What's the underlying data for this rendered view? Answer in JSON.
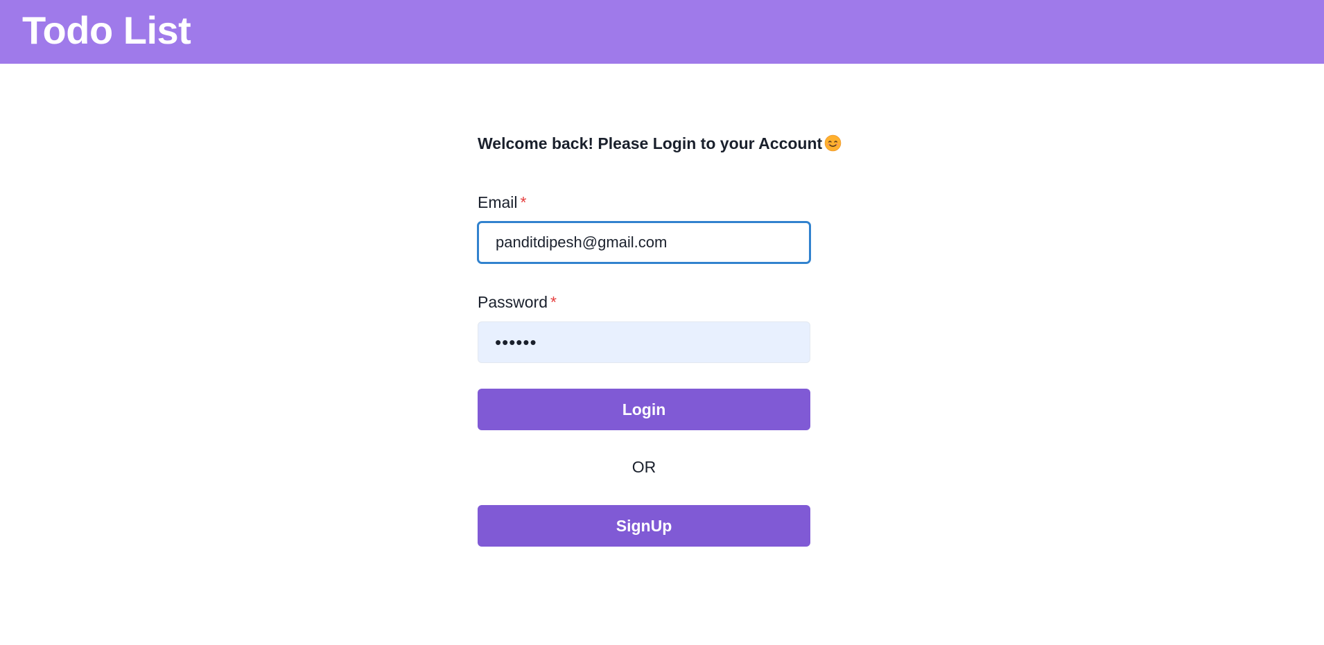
{
  "header": {
    "title": "Todo List",
    "background": "#9f7aea"
  },
  "form": {
    "welcome": "Welcome back! Please Login to your Account",
    "welcome_emoji": "smiling-face-icon",
    "email": {
      "label": "Email",
      "required_mark": "*",
      "value": "panditdipesh@gmail.com"
    },
    "password": {
      "label": "Password",
      "required_mark": "*",
      "value": "••••••"
    },
    "login_label": "Login",
    "or_text": "OR",
    "signup_label": "SignUp",
    "accent_color": "#805ad5",
    "required_color": "#e53e3e",
    "focus_color": "#3182ce"
  }
}
